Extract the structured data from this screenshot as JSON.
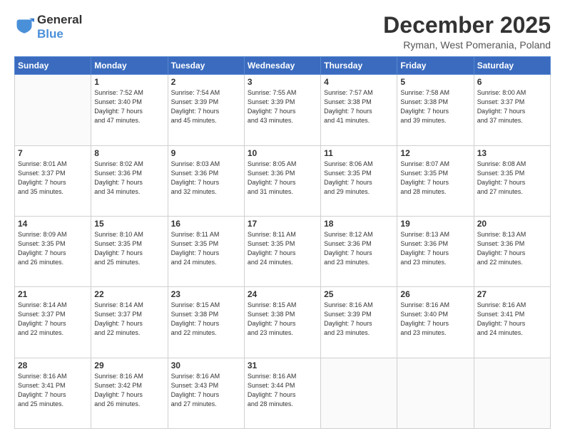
{
  "header": {
    "logo_line1": "General",
    "logo_line2": "Blue",
    "month": "December 2025",
    "location": "Ryman, West Pomerania, Poland"
  },
  "weekdays": [
    "Sunday",
    "Monday",
    "Tuesday",
    "Wednesday",
    "Thursday",
    "Friday",
    "Saturday"
  ],
  "weeks": [
    [
      {
        "day": "",
        "info": ""
      },
      {
        "day": "1",
        "info": "Sunrise: 7:52 AM\nSunset: 3:40 PM\nDaylight: 7 hours\nand 47 minutes."
      },
      {
        "day": "2",
        "info": "Sunrise: 7:54 AM\nSunset: 3:39 PM\nDaylight: 7 hours\nand 45 minutes."
      },
      {
        "day": "3",
        "info": "Sunrise: 7:55 AM\nSunset: 3:39 PM\nDaylight: 7 hours\nand 43 minutes."
      },
      {
        "day": "4",
        "info": "Sunrise: 7:57 AM\nSunset: 3:38 PM\nDaylight: 7 hours\nand 41 minutes."
      },
      {
        "day": "5",
        "info": "Sunrise: 7:58 AM\nSunset: 3:38 PM\nDaylight: 7 hours\nand 39 minutes."
      },
      {
        "day": "6",
        "info": "Sunrise: 8:00 AM\nSunset: 3:37 PM\nDaylight: 7 hours\nand 37 minutes."
      }
    ],
    [
      {
        "day": "7",
        "info": "Sunrise: 8:01 AM\nSunset: 3:37 PM\nDaylight: 7 hours\nand 35 minutes."
      },
      {
        "day": "8",
        "info": "Sunrise: 8:02 AM\nSunset: 3:36 PM\nDaylight: 7 hours\nand 34 minutes."
      },
      {
        "day": "9",
        "info": "Sunrise: 8:03 AM\nSunset: 3:36 PM\nDaylight: 7 hours\nand 32 minutes."
      },
      {
        "day": "10",
        "info": "Sunrise: 8:05 AM\nSunset: 3:36 PM\nDaylight: 7 hours\nand 31 minutes."
      },
      {
        "day": "11",
        "info": "Sunrise: 8:06 AM\nSunset: 3:35 PM\nDaylight: 7 hours\nand 29 minutes."
      },
      {
        "day": "12",
        "info": "Sunrise: 8:07 AM\nSunset: 3:35 PM\nDaylight: 7 hours\nand 28 minutes."
      },
      {
        "day": "13",
        "info": "Sunrise: 8:08 AM\nSunset: 3:35 PM\nDaylight: 7 hours\nand 27 minutes."
      }
    ],
    [
      {
        "day": "14",
        "info": "Sunrise: 8:09 AM\nSunset: 3:35 PM\nDaylight: 7 hours\nand 26 minutes."
      },
      {
        "day": "15",
        "info": "Sunrise: 8:10 AM\nSunset: 3:35 PM\nDaylight: 7 hours\nand 25 minutes."
      },
      {
        "day": "16",
        "info": "Sunrise: 8:11 AM\nSunset: 3:35 PM\nDaylight: 7 hours\nand 24 minutes."
      },
      {
        "day": "17",
        "info": "Sunrise: 8:11 AM\nSunset: 3:35 PM\nDaylight: 7 hours\nand 24 minutes."
      },
      {
        "day": "18",
        "info": "Sunrise: 8:12 AM\nSunset: 3:36 PM\nDaylight: 7 hours\nand 23 minutes."
      },
      {
        "day": "19",
        "info": "Sunrise: 8:13 AM\nSunset: 3:36 PM\nDaylight: 7 hours\nand 23 minutes."
      },
      {
        "day": "20",
        "info": "Sunrise: 8:13 AM\nSunset: 3:36 PM\nDaylight: 7 hours\nand 22 minutes."
      }
    ],
    [
      {
        "day": "21",
        "info": "Sunrise: 8:14 AM\nSunset: 3:37 PM\nDaylight: 7 hours\nand 22 minutes."
      },
      {
        "day": "22",
        "info": "Sunrise: 8:14 AM\nSunset: 3:37 PM\nDaylight: 7 hours\nand 22 minutes."
      },
      {
        "day": "23",
        "info": "Sunrise: 8:15 AM\nSunset: 3:38 PM\nDaylight: 7 hours\nand 22 minutes."
      },
      {
        "day": "24",
        "info": "Sunrise: 8:15 AM\nSunset: 3:38 PM\nDaylight: 7 hours\nand 23 minutes."
      },
      {
        "day": "25",
        "info": "Sunrise: 8:16 AM\nSunset: 3:39 PM\nDaylight: 7 hours\nand 23 minutes."
      },
      {
        "day": "26",
        "info": "Sunrise: 8:16 AM\nSunset: 3:40 PM\nDaylight: 7 hours\nand 23 minutes."
      },
      {
        "day": "27",
        "info": "Sunrise: 8:16 AM\nSunset: 3:41 PM\nDaylight: 7 hours\nand 24 minutes."
      }
    ],
    [
      {
        "day": "28",
        "info": "Sunrise: 8:16 AM\nSunset: 3:41 PM\nDaylight: 7 hours\nand 25 minutes."
      },
      {
        "day": "29",
        "info": "Sunrise: 8:16 AM\nSunset: 3:42 PM\nDaylight: 7 hours\nand 26 minutes."
      },
      {
        "day": "30",
        "info": "Sunrise: 8:16 AM\nSunset: 3:43 PM\nDaylight: 7 hours\nand 27 minutes."
      },
      {
        "day": "31",
        "info": "Sunrise: 8:16 AM\nSunset: 3:44 PM\nDaylight: 7 hours\nand 28 minutes."
      },
      {
        "day": "",
        "info": ""
      },
      {
        "day": "",
        "info": ""
      },
      {
        "day": "",
        "info": ""
      }
    ]
  ]
}
